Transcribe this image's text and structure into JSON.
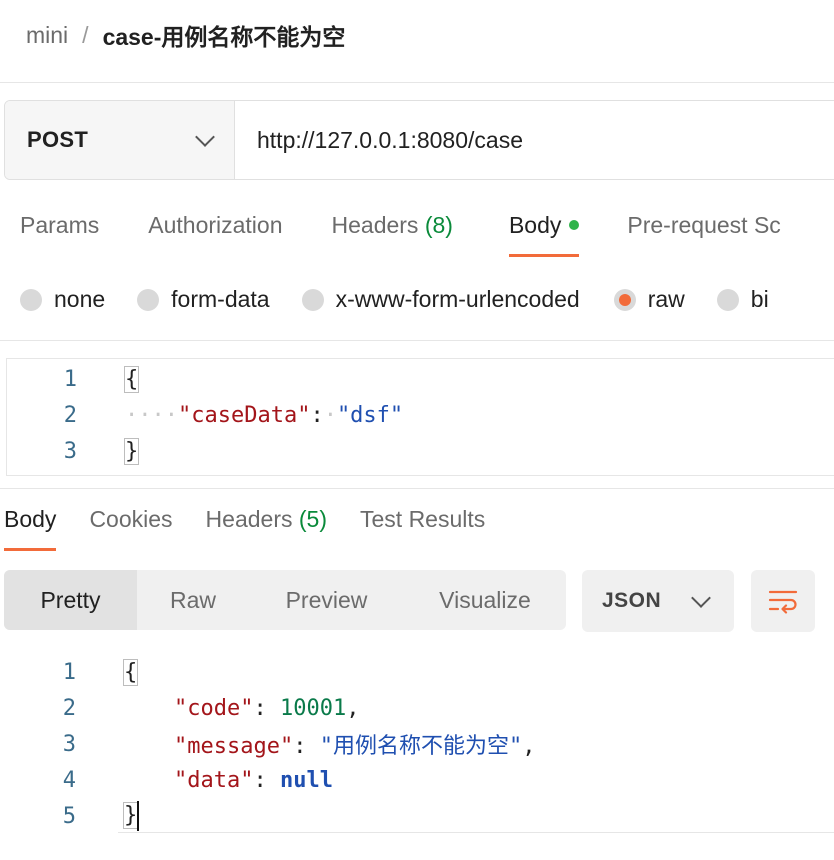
{
  "breadcrumb": {
    "parent": "mini",
    "separator": "/",
    "current": "case-用例名称不能为空"
  },
  "request": {
    "method": "POST",
    "url": "http://127.0.0.1:8080/case",
    "tabs": [
      {
        "label": "Params"
      },
      {
        "label": "Authorization"
      },
      {
        "label": "Headers",
        "count": "(8)"
      },
      {
        "label": "Body",
        "active": true,
        "indicator_color": "#2fb34a"
      },
      {
        "label": "Pre-request Sc"
      }
    ],
    "body_types": [
      {
        "label": "none"
      },
      {
        "label": "form-data"
      },
      {
        "label": "x-www-form-urlencoded"
      },
      {
        "label": "raw",
        "selected": true
      },
      {
        "label": "bi"
      }
    ],
    "body_editor": {
      "lines": [
        {
          "n": "1",
          "open": "{"
        },
        {
          "n": "2",
          "ws": "····",
          "key": "\"caseData\"",
          "colon": ":",
          "ws2": "·",
          "value": "\"dsf\""
        },
        {
          "n": "3",
          "close": "}"
        }
      ]
    }
  },
  "response": {
    "tabs": [
      {
        "label": "Body",
        "active": true
      },
      {
        "label": "Cookies"
      },
      {
        "label": "Headers",
        "count": "(5)"
      },
      {
        "label": "Test Results"
      }
    ],
    "views": [
      "Pretty",
      "Raw",
      "Preview",
      "Visualize"
    ],
    "active_view": "Pretty",
    "format": "JSON",
    "wrap_icon": "wrap-lines-icon",
    "body": {
      "lines": [
        {
          "n": "1",
          "open": "{"
        },
        {
          "n": "2",
          "key": "\"code\"",
          "colon": ": ",
          "value": "10001",
          "comma": ","
        },
        {
          "n": "3",
          "key": "\"message\"",
          "colon": ": ",
          "value": "\"用例名称不能为空\"",
          "comma": ","
        },
        {
          "n": "4",
          "key": "\"data\"",
          "colon": ": ",
          "value": "null"
        },
        {
          "n": "5",
          "close": "}"
        }
      ]
    }
  },
  "colors": {
    "accent": "#f26b3a",
    "status_green": "#0a8a3a",
    "json_key": "#a3151a",
    "json_string": "#1f4fb0"
  }
}
